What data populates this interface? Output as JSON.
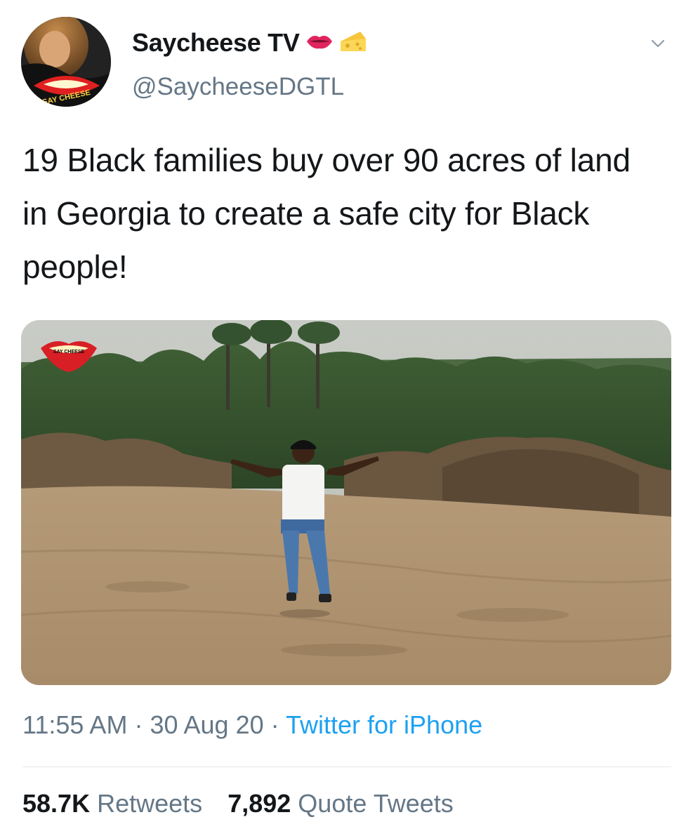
{
  "author": {
    "display_name": "Saycheese TV",
    "emojis": [
      "lips-icon",
      "cheese-icon"
    ],
    "handle": "@SaycheeseDGTL",
    "avatar_text": "SAY CHEESE"
  },
  "tweet": {
    "text": "19 Black families buy over 90 acres of land in Georgia to create a safe city for Black people!"
  },
  "media": {
    "watermark_text": "SAY CHEESE"
  },
  "meta": {
    "time": "11:55 AM",
    "separator": "·",
    "date": "30 Aug 20",
    "source": "Twitter for iPhone"
  },
  "stats": {
    "retweets_count": "58.7K",
    "retweets_label": "Retweets",
    "quotes_count": "7,892",
    "quotes_label": "Quote Tweets"
  },
  "colors": {
    "text": "#14171a",
    "secondary": "#657786",
    "link": "#1da1f2",
    "divider": "#e1e8ed"
  }
}
